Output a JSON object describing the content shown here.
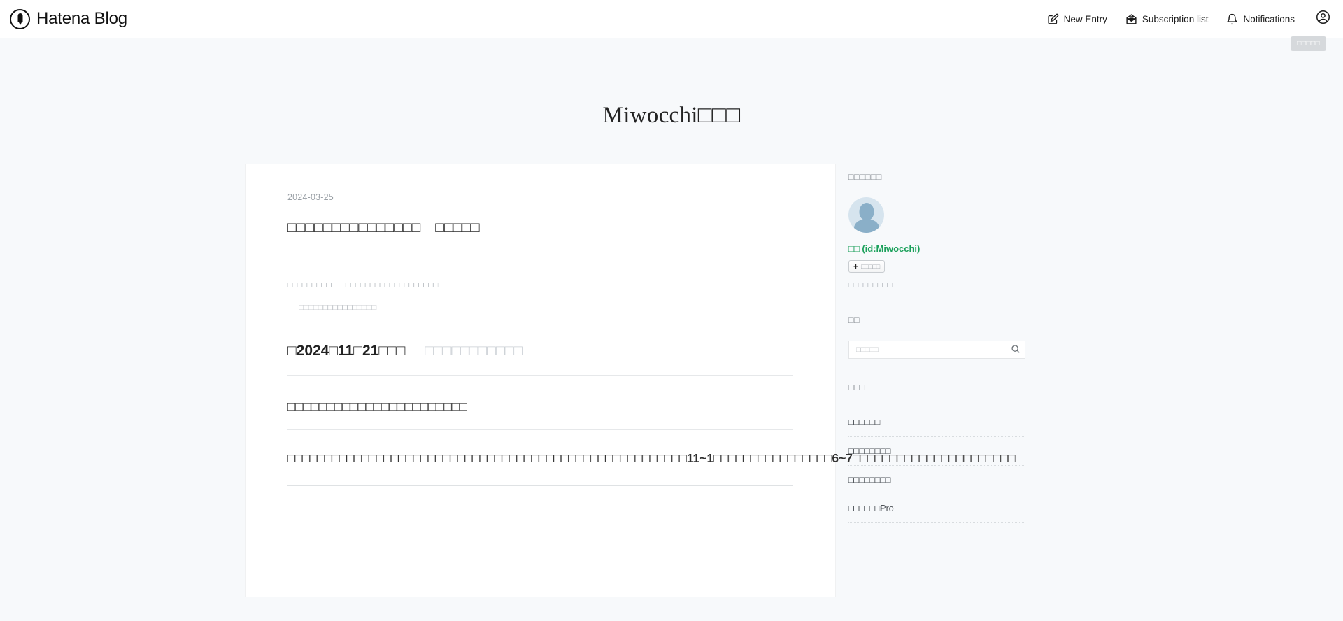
{
  "global_header": {
    "brand_label": "Hatena Blog",
    "brand_icon": "pen-circle-icon",
    "nav": [
      {
        "label": "New Entry",
        "icon": "pencil-square-icon"
      },
      {
        "label": "Subscription list",
        "icon": "envelope-open-icon"
      },
      {
        "label": "Notifications",
        "icon": "bell-icon"
      }
    ],
    "account_icon": "user-circle-icon"
  },
  "edit_button": {
    "label": "□□□□□"
  },
  "blog": {
    "title": "Miwocchi□□□"
  },
  "entry": {
    "date": "2024-03-25",
    "title": "□□□□□□□□□□□□□□□　□□□□□",
    "note_line1": "□□□□□□□□□□□□□□□□□□□□□□□□□□□□□□□",
    "note_line2": "□□□□□□□□□□□□□□□□",
    "heading_major_main": "□2024□11□21□□□",
    "heading_major_sub": "□□□□□□□□□□□",
    "heading_minor": "□□□□□□□□□□□□□□□□□□□□□□□",
    "paragraph": "□□□□□□□□□□□□□□□□□□□□□□□□□□□□□□□□□□□□□□□□□□□□□□□□□□□□□□11~1□□□□□□□□□□□□□□□□6~7□□□□□□□□□□□□□□□□□□□□□□"
  },
  "sidebar": {
    "profile": {
      "title": "□□□□□□",
      "avatar_icon": "default-user-avatar",
      "id_label": "□□ (id:Miwocchi)",
      "subscribe_label": "□□□□□",
      "subscribe_icon": "plus-icon",
      "description": "□□□□□□□□□"
    },
    "search": {
      "title": "□□",
      "placeholder": "□□□□□",
      "value": "",
      "icon": "search-icon"
    },
    "categories": {
      "title": "□□□",
      "items": [
        {
          "label": "□□□□□□"
        },
        {
          "label": "□□□□□□□□"
        },
        {
          "label": "□□□□□□□□"
        },
        {
          "label": "□□□□□□Pro"
        }
      ]
    }
  },
  "colors": {
    "page_bg": "#f7f9fb",
    "card_bg": "#ffffff",
    "accent_green": "#1aa05a",
    "muted_text": "#9aa0a6"
  }
}
